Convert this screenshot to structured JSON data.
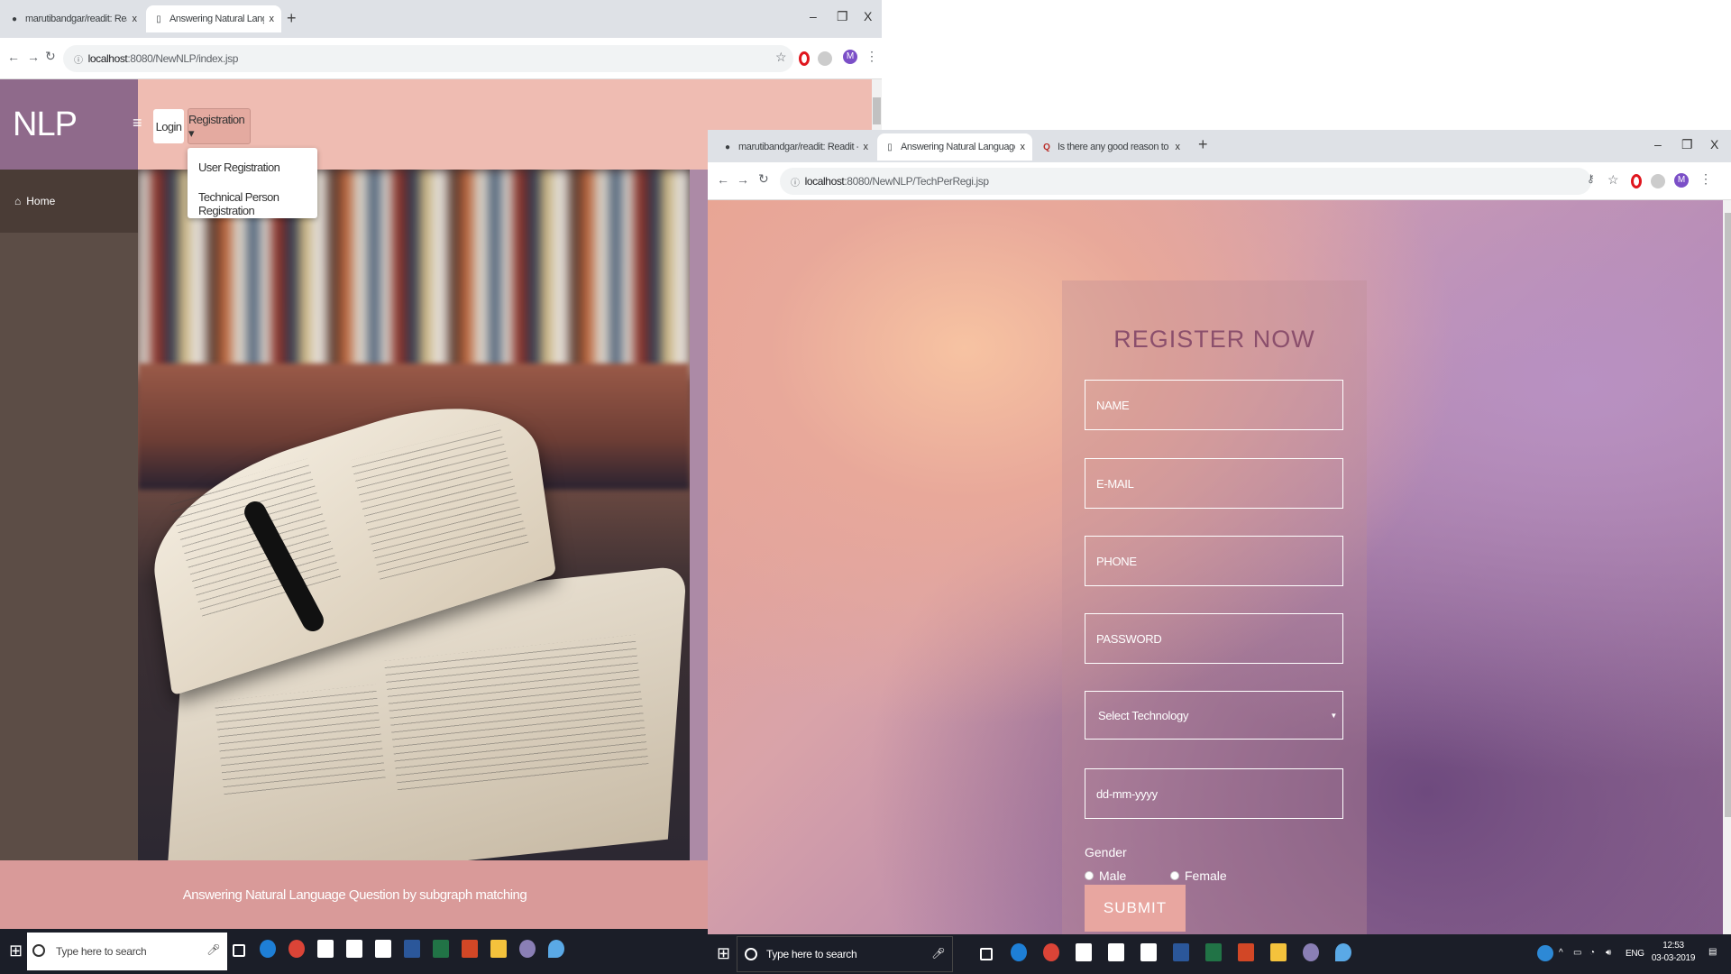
{
  "left_window": {
    "tabs": [
      {
        "title": "marutibandgar/readit: Readit - G",
        "close": "x"
      },
      {
        "title": "Answering Natural Language qu",
        "close": "x"
      }
    ],
    "new_tab": "+",
    "controls": {
      "minimize": "–",
      "restore": "❐",
      "close": "X"
    },
    "url_host": "localhost",
    "url_rest": ":8080/NewNLP/index.jsp",
    "brand": "NLP",
    "menu_icon": "≡",
    "nav": {
      "login": "Login",
      "registration": "Registration ▾"
    },
    "dropdown": [
      "User Registration",
      "Technical Person Registration"
    ],
    "sidebar": {
      "home": "Home"
    },
    "footer": "Answering Natural Language Question by subgraph matching"
  },
  "right_window": {
    "tabs": [
      {
        "title": "marutibandgar/readit: Readit - G",
        "close": "x"
      },
      {
        "title": "Answering Natural Language Qu",
        "close": "x"
      },
      {
        "title": "Is there any good reason to hav",
        "close": "x"
      }
    ],
    "new_tab": "+",
    "controls": {
      "minimize": "–",
      "restore": "❐",
      "close": "X"
    },
    "url_host": "localhost",
    "url_rest": ":8080/NewNLP/TechPerRegi.jsp",
    "form": {
      "title": "REGISTER NOW",
      "name": "NAME",
      "email": "E-MAIL",
      "phone": "PHONE",
      "password": "PASSWORD",
      "technology": "Select Technology",
      "date": "dd-mm-yyyy",
      "gender_label": "Gender",
      "male": "Male",
      "female": "Female",
      "submit": "SUBMIT"
    }
  },
  "taskbar_left": {
    "search": "Type here to search"
  },
  "taskbar_right": {
    "search": "Type here to search",
    "lang": "ENG",
    "time": "12:53",
    "date": "03-03-2019"
  },
  "colors": {
    "brand": "#8f6a8b",
    "topbar": "#efbcb2",
    "footer": "#d99a99",
    "title": "#8b4f6c",
    "submit": "#e8a6a0"
  }
}
